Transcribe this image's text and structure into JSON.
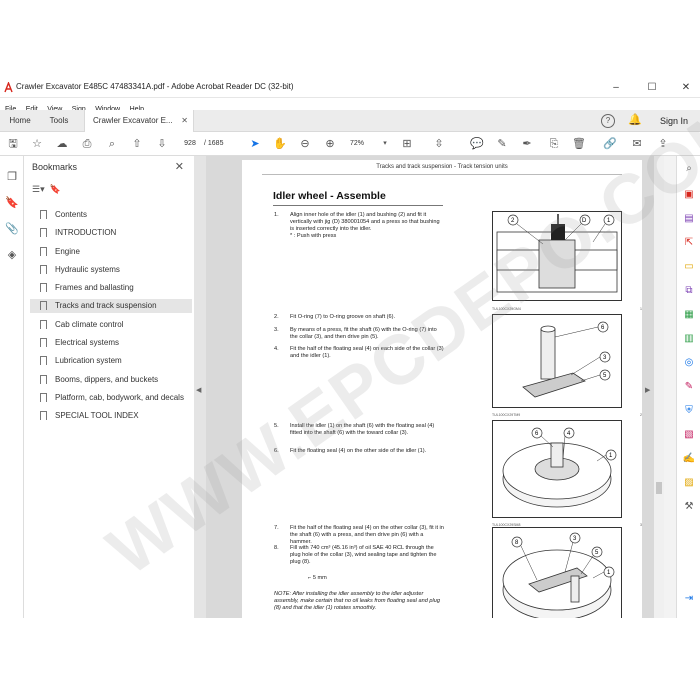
{
  "window": {
    "title": "Crawler Excavator E485C 47483341A.pdf - Adobe Acrobat Reader DC (32-bit)",
    "minimize": "–",
    "maximize": "☐",
    "close": "✕"
  },
  "menu": [
    "File",
    "Edit",
    "View",
    "Sign",
    "Window",
    "Help"
  ],
  "tabs": {
    "home": "Home",
    "tools": "Tools",
    "document": "Crawler Excavator E...",
    "close": "✕",
    "help": "?",
    "signin": "Sign In"
  },
  "toolbar": {
    "page_current": "928",
    "page_total": "/ 1685",
    "zoom": "72%"
  },
  "bookmarks": {
    "title": "Bookmarks",
    "close": "✕",
    "items": [
      "Contents",
      "INTRODUCTION",
      "Engine",
      "Hydraulic systems",
      "Frames and ballasting",
      "Tracks and track suspension",
      "Cab climate control",
      "Electrical systems",
      "Lubrication system",
      "Booms, dippers, and buckets",
      "Platform, cab, bodywork, and decals",
      "SPECIAL TOOL INDEX"
    ],
    "selected_index": 5
  },
  "page": {
    "header": "Tracks and track suspension - Track tension units",
    "title": "Idler wheel - Assemble",
    "steps": [
      {
        "n": "1.",
        "t": "Align inner hole of the idler (1) and bushing (2) and fit it vertically with jig (D) 380001054 and a press so that bushing is inserted correctly into the idler."
      },
      {
        "n": "",
        "t": "* : Push with press"
      },
      {
        "n": "2.",
        "t": "Fit O-ring (7) to O-ring groove on shaft (6)."
      },
      {
        "n": "3.",
        "t": "By means of a press, fit the shaft (6) with the O-ring (7) into the collar (3), and then drive pin (5)."
      },
      {
        "n": "4.",
        "t": "Fit the half of the floating seal (4) on each side of the collar (3) and the idler (1)."
      },
      {
        "n": "5.",
        "t": "Install the idler (1) on the shaft (6) with the floating seal (4) fitted into the shaft (6) with the toward collar (3)."
      },
      {
        "n": "6.",
        "t": "Fit the floating seal (4) on the other side of the idler (1)."
      },
      {
        "n": "7.",
        "t": "Fit the half of the floating seal (4) on the other collar (3), fit it in the shaft (6) with a press, and then drive pin (6) with a hammer."
      },
      {
        "n": "8.",
        "t": "Fill with 740 cm³ (45.16 in³) of oil SAE 40 RCL through the plug hole of the collar (3), wind sealing tape and tighten the plug (8)."
      }
    ],
    "torque": "5 mm",
    "note": "NOTE: After installing the idler assembly to the idler adjuster assembly, make certain that no oil leaks from floating seal and plug (8) and that the idler (1) rotates smoothly.",
    "figures": [
      {
        "code": "TUL100CX29GM4",
        "no": "1"
      },
      {
        "code": "TUL100CX29TM9",
        "no": "2"
      },
      {
        "code": "TUL100CX29SM8",
        "no": "3"
      },
      {
        "code": "TUL100CX29SM9",
        "no": "4"
      }
    ]
  },
  "watermark": "WWW.EPCDEPO.COM",
  "colors": {
    "accent": "#1473e6",
    "page_bg": "#d9d9d9"
  }
}
